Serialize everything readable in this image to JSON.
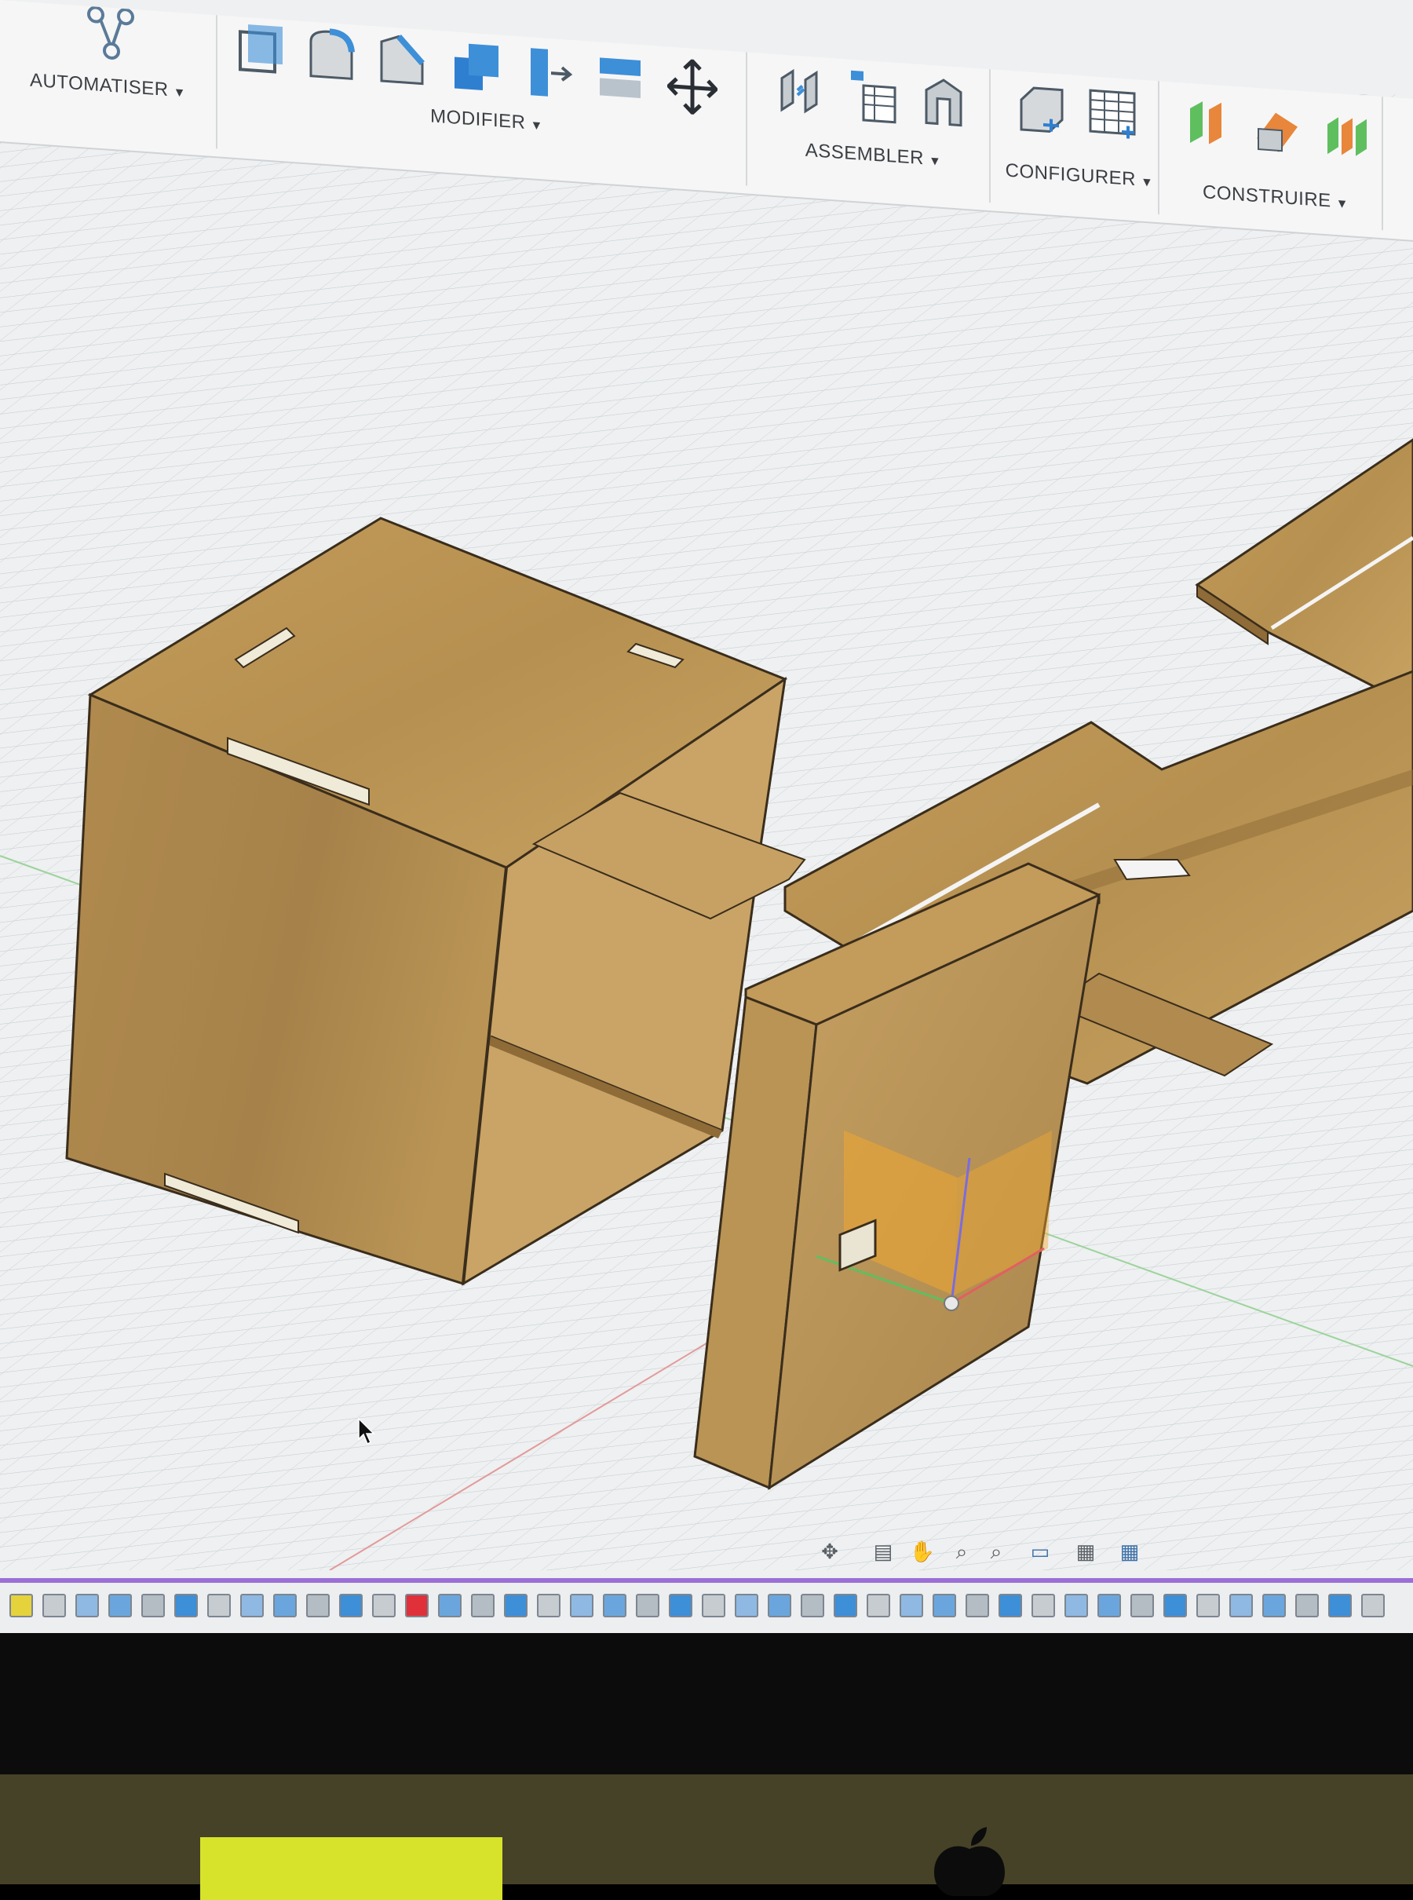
{
  "toolbar": {
    "groups": [
      {
        "id": "automate",
        "label": "AUTOMATISER"
      },
      {
        "id": "modify",
        "label": "MODIFIER"
      },
      {
        "id": "assemble",
        "label": "ASSEMBLER"
      },
      {
        "id": "configure",
        "label": "CONFIGURER"
      },
      {
        "id": "construct",
        "label": "CONSTRUIRE"
      }
    ],
    "dropdown_icon": "caret-down-icon"
  },
  "colors": {
    "wood_light": "#c8a261",
    "wood_mid": "#b08a4e",
    "wood_dark": "#8e6b37",
    "edge": "#3a2d1c",
    "grid": "#c9ced2",
    "toolbar_blue": "#3d8fd8",
    "selection_orange": "#f0a830",
    "timeline_accent": "#9b6fd6"
  },
  "navigation_bar": {
    "tools": [
      "orbit-icon",
      "look-at-icon",
      "pan-icon",
      "zoom-icon",
      "fit-icon",
      "display-settings-icon",
      "grid-settings-icon",
      "viewports-icon"
    ]
  },
  "timeline": {
    "feature_count": 42
  }
}
